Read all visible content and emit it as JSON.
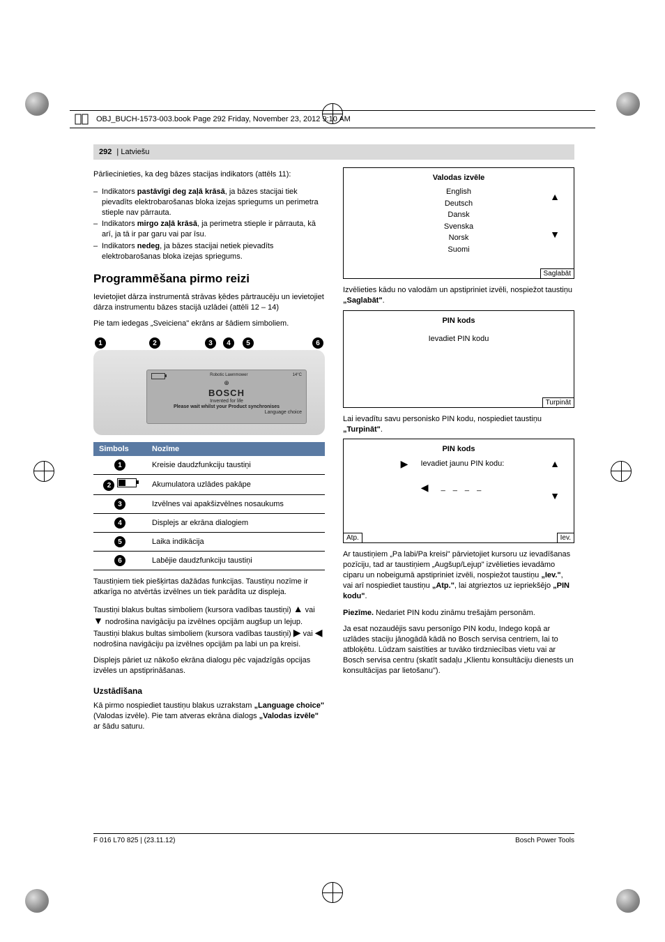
{
  "meta": {
    "header_line": "OBJ_BUCH-1573-003.book  Page 292  Friday, November 23, 2012  9:10 AM",
    "page_label": "292",
    "lang_label": "Latviešu",
    "footer_left": "F 016 L70 825 | (23.11.12)",
    "footer_right": "Bosch Power Tools"
  },
  "left": {
    "intro": "Pārliecinieties, ka deg bāzes stacijas indikators (attēls 11):",
    "bullets": [
      {
        "lead": "Indikators ",
        "bold": "pastāvīgi deg zaļā krāsā",
        "tail": ", ja bāzes stacijai tiek pievadīts elektrobarošanas bloka izejas spriegums un perimetra stieple nav pārrauta."
      },
      {
        "lead": "Indikators ",
        "bold": "mirgo zaļā krāsā",
        "tail": ", ja perimetra stieple ir pārrauta, kā arī, ja tā ir par garu vai par īsu."
      },
      {
        "lead": "Indikators ",
        "bold": "nedeg",
        "tail": ", ja bāzes stacijai netiek pievadīts elektrobarošanas bloka izejas spriegums."
      }
    ],
    "h2": "Programmēšana pirmo reizi",
    "p_after_h2_1": "Ievietojiet dārza instrumentā strāvas ķēdes pārtraucēju un ievietojiet dārza instrumentu bāzes stacijā uzlādei (attēli 12 – 14)",
    "p_after_h2_2": "Pie tam iedegas „Sveiciena\" ekrāns ar šādiem simboliem.",
    "device": {
      "top_left": "Robotic Lawnmower",
      "top_right": "14°C",
      "brand": "BOSCH",
      "sub1": "Invented for life",
      "sub2": "Please wait whilst your Product synchronises",
      "sub3": "Language choice"
    },
    "callouts": [
      "1",
      "2",
      "3",
      "4",
      "5",
      "6"
    ],
    "table_head": [
      "Simbols",
      "Nozīme"
    ],
    "table_rows": [
      {
        "n": "1",
        "icon": "",
        "text": "Kreisie daudzfunkciju taustiņi"
      },
      {
        "n": "2",
        "icon": "battery",
        "text": "Akumulatora uzlādes pakāpe"
      },
      {
        "n": "3",
        "icon": "",
        "text": "Izvēlnes vai apakšizvēlnes nosaukums"
      },
      {
        "n": "4",
        "icon": "",
        "text": "Displejs ar ekrāna dialogiem"
      },
      {
        "n": "5",
        "icon": "",
        "text": "Laika indikācija"
      },
      {
        "n": "6",
        "icon": "",
        "text": "Labējie daudzfunkciju taustiņi"
      }
    ],
    "p_buttons_1": "Taustiņiem tiek piešķirtas dažādas funkcijas. Taustiņu nozīme ir atkarīga no atvērtās izvēlnes un tiek parādīta uz displeja.",
    "p_buttons_2a": "Taustiņi blakus bultas simboliem (kursora vadības taustiņi) ",
    "p_buttons_2b": " vai ",
    "p_buttons_2c": " nodrošina navigāciju pa izvēlnes opcijām augšup un lejup. Taustiņi blakus bultas simboliem (kursora vadības taustiņi) ",
    "p_buttons_2d": " vai ",
    "p_buttons_2e": " nodrošina navigāciju pa izvēlnes opcijām pa labi un pa kreisi.",
    "p_buttons_3": "Displejs pāriet uz nākošo ekrāna dialogu pēc vajadzīgās opcijas izvēles un apstiprināšanas.",
    "h3": "Uzstādīšana",
    "p_setup_a": "Kā pirmo nospiediet taustiņu blakus uzrakstam ",
    "p_setup_bold1": "„Language choice\"",
    "p_setup_b": " (Valodas izvēle). Pie tam atveras ekrāna dialogs ",
    "p_setup_bold2": "„Valodas izvēle\"",
    "p_setup_c": " ar šādu saturu."
  },
  "right": {
    "lang_box": {
      "title": "Valodas izvēle",
      "items": [
        "English",
        "Deutsch",
        "Dansk",
        "Svenska",
        "Norsk",
        "Suomi"
      ],
      "save": "Saglabāt"
    },
    "p1a": "Izvēlieties kādu no valodām un apstipriniet izvēli, nospiežot taustiņu ",
    "p1b": "„Saglabāt\"",
    "p1c": ".",
    "pin_box1": {
      "title": "PIN kods",
      "text": "Ievadiet PIN kodu",
      "btn": "Turpināt"
    },
    "p2a": "Lai ievadītu savu personisko PIN kodu, nospiediet taustiņu ",
    "p2b": "„Turpināt\"",
    "p2c": ".",
    "pin_box2": {
      "title": "PIN kods",
      "text": "Ievadiet jaunu PIN kodu:",
      "code": "_ _ _ _",
      "bl": "Atp.",
      "br": "Iev."
    },
    "p3a": "Ar taustiņiem „Pa labi/Pa kreisi\" pārvietojiet kursoru uz ievadīšanas pozīciju, tad ar taustiņiem „Augšup/Lejup\" izvēlieties ievadāmo ciparu un nobeigumā apstipriniet izvēli, nospiežot taustiņu ",
    "p3b": "„Iev.\"",
    "p3c": ", vai arī nospiediet taustiņu ",
    "p3d": "„Atp.\"",
    "p3e": ", lai atgrieztos uz iepriekšējo ",
    "p3f": "„PIN kodu\"",
    "p3g": ".",
    "note_lead": "Piezīme.",
    "note_text": " Nedariet PIN kodu zināmu trešajām personām.",
    "p4": "Ja esat nozaudējis savu personīgo PIN kodu, Indego kopā ar uzlādes staciju jānogādā kādā no Bosch servisa centriem, lai to atbloķētu. Lūdzam saistīties ar tuvāko tirdzniecības vietu vai ar Bosch servisa centru (skatīt sadaļu „Klientu konsultāciju dienests un konsultācijas par lietošanu\")."
  }
}
